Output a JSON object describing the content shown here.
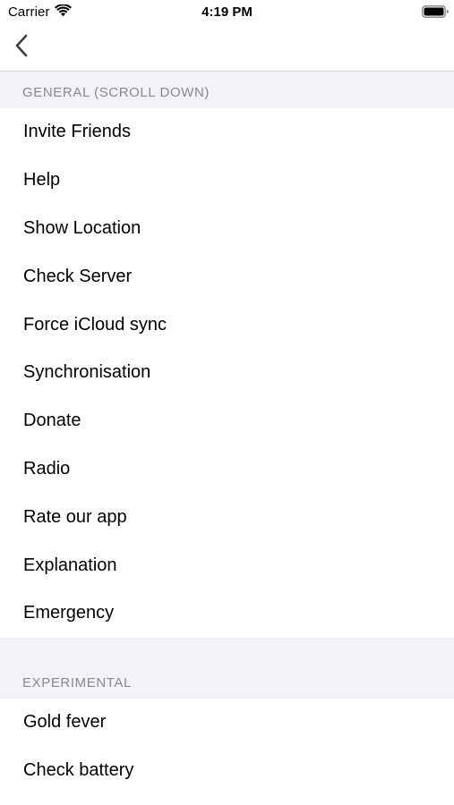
{
  "status_bar": {
    "carrier": "Carrier",
    "time": "4:19 PM"
  },
  "nav": {
    "back_icon": "chevron-left-icon",
    "accent_color": "#3c3c43"
  },
  "sections": [
    {
      "header": "GENERAL (SCROLL DOWN)",
      "items": [
        "Invite Friends",
        "Help",
        "Show Location",
        "Check Server",
        "Force iCloud sync",
        "Synchronisation",
        "Donate",
        "Radio",
        "Rate our app",
        "Explanation",
        "Emergency"
      ]
    },
    {
      "header": "EXPERIMENTAL",
      "items": [
        "Gold fever",
        "Check battery"
      ]
    }
  ],
  "colors": {
    "background": "#ffffff",
    "grouped_background": "#f2f2f7",
    "section_header_text": "#8a8a8e",
    "separator": "#d8d8dc"
  }
}
